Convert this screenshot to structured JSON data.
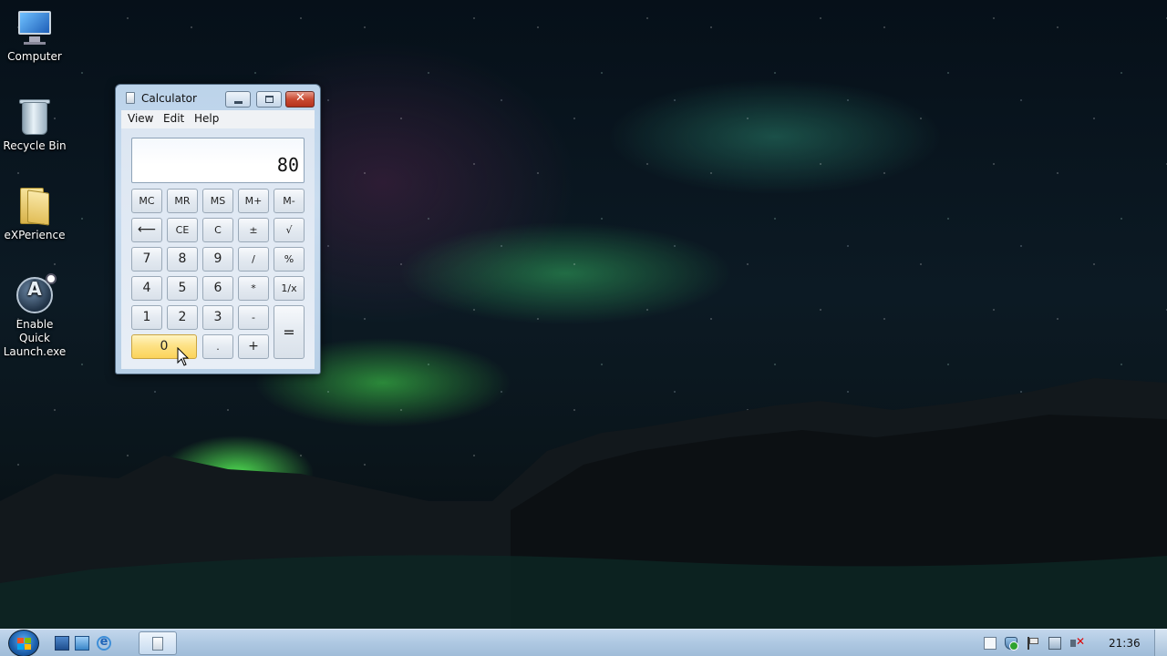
{
  "desktop": {
    "icons": [
      {
        "label": "Computer",
        "icon": "computer-icon"
      },
      {
        "label": "Recycle Bin",
        "icon": "recycle-bin-icon"
      },
      {
        "label": "eXPerience",
        "icon": "folder-icon"
      },
      {
        "label": "Enable Quick Launch.exe",
        "icon": "quick-launch-app-icon"
      }
    ]
  },
  "calculator": {
    "title": "Calculator",
    "menu": [
      "View",
      "Edit",
      "Help"
    ],
    "display": "80",
    "keys": {
      "mc": "MC",
      "mr": "MR",
      "ms": "MS",
      "mplus": "M+",
      "mminus": "M-",
      "backspace": "⟵",
      "ce": "CE",
      "c": "C",
      "plusminus": "±",
      "sqrt": "√",
      "seven": "7",
      "eight": "8",
      "nine": "9",
      "divide": "/",
      "percent": "%",
      "four": "4",
      "five": "5",
      "six": "6",
      "multiply": "*",
      "reciprocal": "1/x",
      "one": "1",
      "two": "2",
      "three": "3",
      "minus": "-",
      "equals": "=",
      "zero": "0",
      "decimal": ".",
      "plus": "+"
    }
  },
  "taskbar": {
    "clock": "21:36",
    "pinned": [
      "show-desktop-icon",
      "windows-explorer-icon",
      "internet-explorer-icon"
    ],
    "tasks": [
      "calculator-task"
    ],
    "tray": [
      "action-center-doc-icon",
      "security-shield-icon",
      "flag-icon",
      "network-icon",
      "volume-muted-icon"
    ]
  },
  "colors": {
    "zero_key_highlight": "#fde287",
    "close_button": "#c94a32",
    "taskbar": "#aec8e2"
  }
}
